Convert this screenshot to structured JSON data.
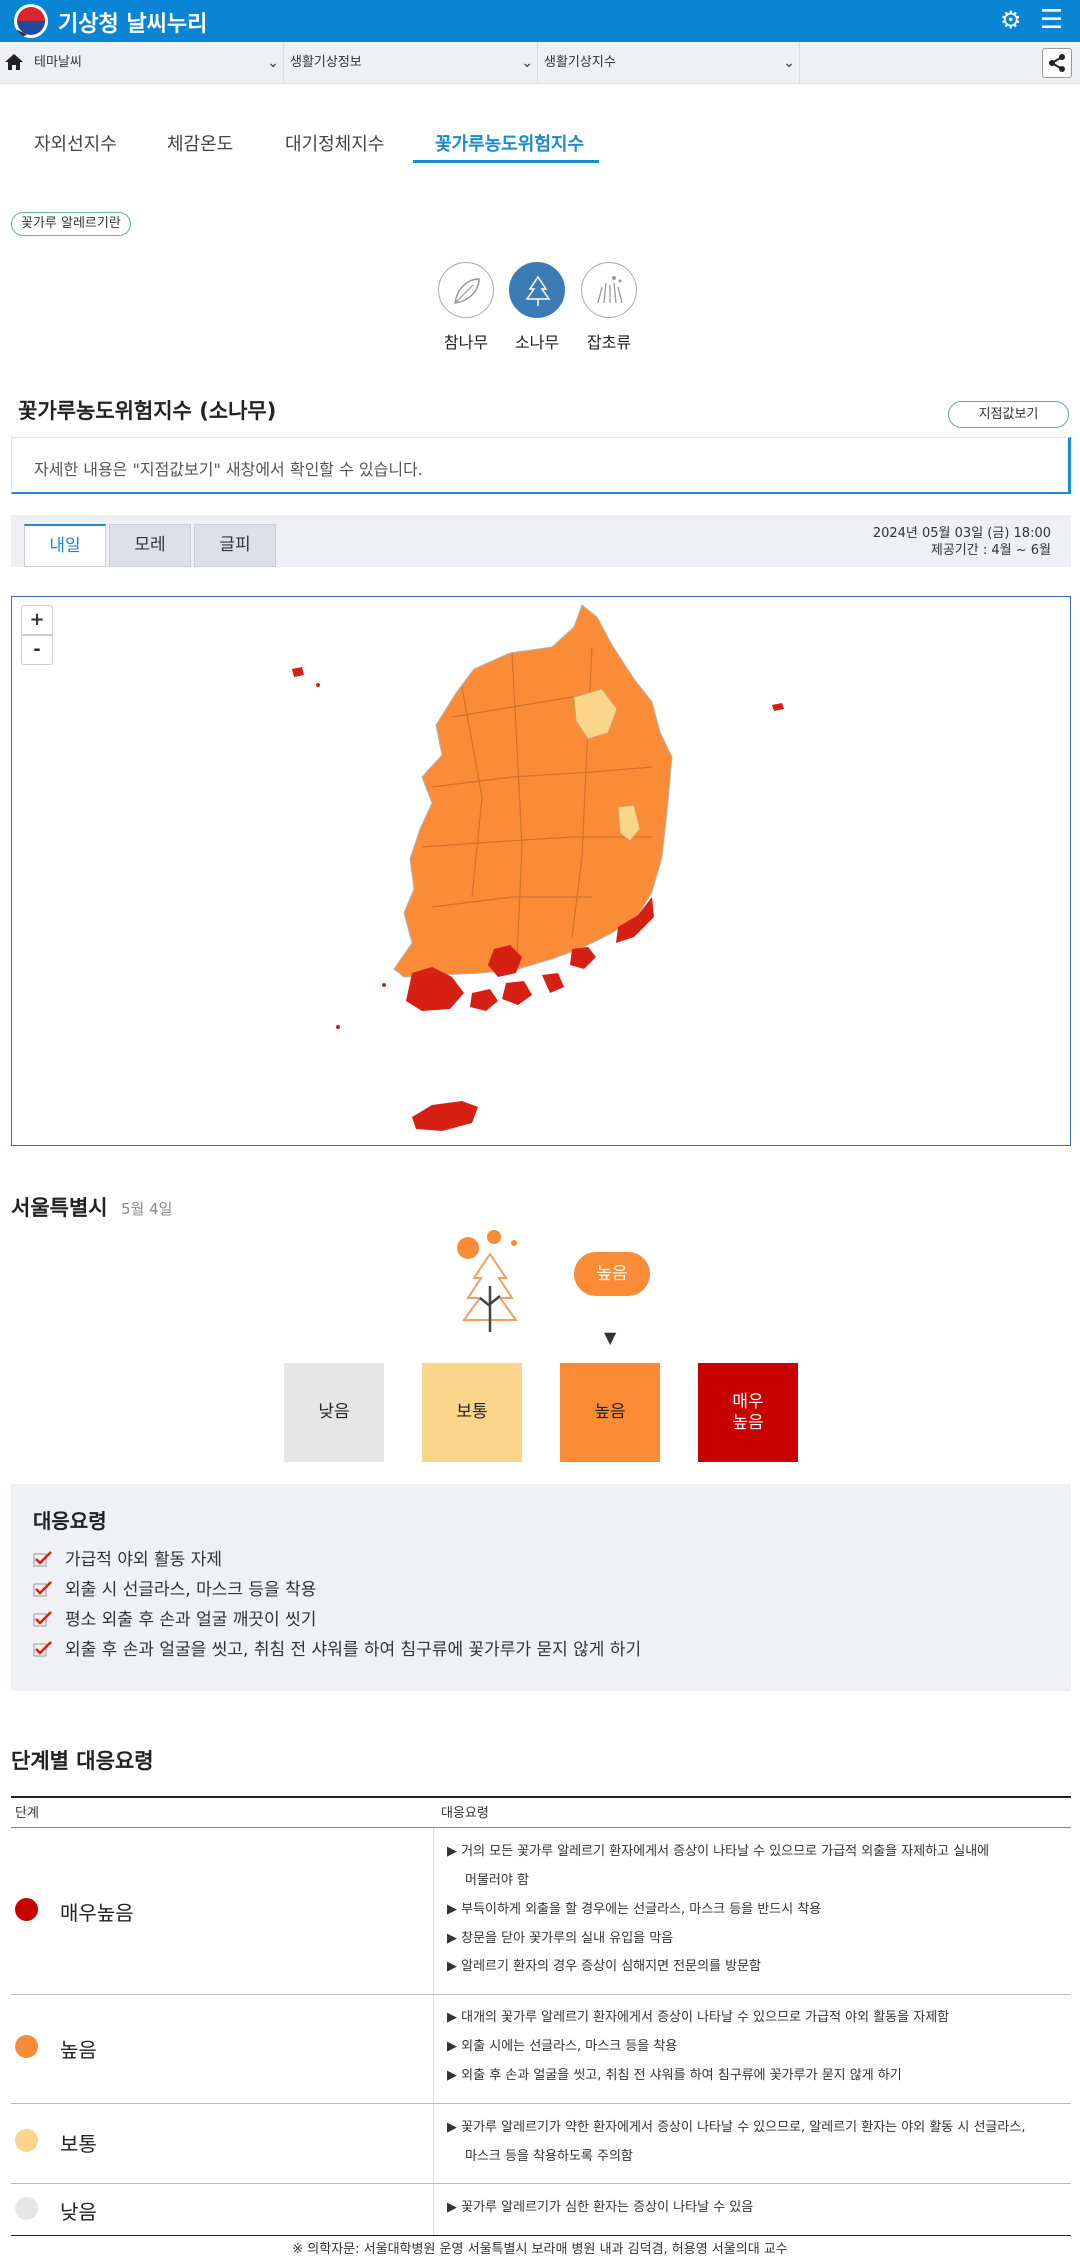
{
  "header": {
    "title": "기상청 날씨누리"
  },
  "selects": [
    "테마날씨",
    "생활기상정보",
    "생활기상지수"
  ],
  "index_tabs": [
    "자외선지수",
    "체감온도",
    "대기정체지수",
    "꽃가루농도위험지수"
  ],
  "allergy_pill": "꽃가루 알레르기란",
  "trees": [
    "참나무",
    "소나무",
    "잡초류"
  ],
  "section": {
    "title": "꽃가루농도위험지수 (소나무)",
    "point_button": "지점값보기",
    "notice": "자세한 내용은 \"지점값보기\" 새창에서 확인할 수 있습니다."
  },
  "day_tabs": [
    "내일",
    "모레",
    "글피"
  ],
  "day_info": {
    "issued": "2024년 05월 03일 (금) 18:00",
    "period": "제공기간 : 4월 ~ 6월"
  },
  "map": {
    "zoom_in": "+",
    "zoom_out": "-"
  },
  "city": {
    "name": "서울특별시",
    "date": "5월 4일",
    "level": "높음",
    "arrow": "▼"
  },
  "levels": [
    {
      "label": "낮음",
      "color": "#e6e6e6",
      "text_color": "#222222"
    },
    {
      "label": "보통",
      "color": "#fbd68a",
      "text_color": "#222222"
    },
    {
      "label": "높음",
      "color": "#fb8c37",
      "text_color": "#222222"
    },
    {
      "label": "매우\n높음",
      "color": "#c90000",
      "text_color": "#ffffff"
    }
  ],
  "response": {
    "title": "대응요령",
    "items": [
      "가급적 야외 활동 자제",
      "외출 시 선글라스, 마스크 등을 착용",
      "평소 외출 후 손과 얼굴 깨끗이 씻기",
      "외출 후 손과 얼굴을 씻고, 취침 전 샤워를 하여 침구류에 꽃가루가 묻지 않게 하기"
    ]
  },
  "stage_table": {
    "title": "단계별 대응요령",
    "col_stage": "단계",
    "col_resp": "대응요령",
    "rows": [
      {
        "name": "매우높음",
        "color": "#c90000",
        "bullets": [
          "거의 모든 꽃가루 알레르기 환자에게서 증상이 나타날 수 있으므로 가급적 외출을 자제하고 실내에",
          "머물러야 함",
          "부득이하게 외출을 할 경우에는 선글라스, 마스크 등을 반드시 착용",
          "창문을 닫아 꽃가루의 실내 유입을 막음",
          "알레르기 환자의 경우 증상이 심해지면 전문의를 방문함"
        ]
      },
      {
        "name": "높음",
        "color": "#fb8c37",
        "bullets": [
          "대개의 꽃가루 알레르기 환자에게서 증상이 나타날 수 있으므로 가급적 야외 활동을 자제함",
          "외출 시에는 선글라스, 마스크 등을 착용",
          "외출 후 손과 얼굴을 씻고, 취침 전 샤워를 하여 침구류에 꽃가루가 묻지 않게 하기"
        ]
      },
      {
        "name": "보통",
        "color": "#fbd68a",
        "bullets": [
          "꽃가루 알레르기가 약한 환자에게서 증상이 나타날 수 있으므로, 알레르기 환자는 야외 활동 시 선글라스,",
          "마스크 등을 착용하도록 주의함"
        ]
      },
      {
        "name": "낮음",
        "color": "#e6e6e6",
        "bullets": [
          "꽃가루 알레르기가 심한 환자는 증상이 나타날 수 있음"
        ]
      }
    ]
  },
  "footnote": "※ 의학자문: 서울대학병원 운영 서울특별시 보라매 병원 내과 김덕겸, 허용영 서울의대 교수"
}
